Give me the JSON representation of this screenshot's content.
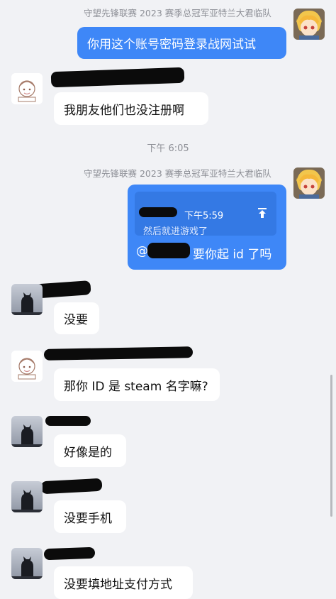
{
  "messages": {
    "m1": {
      "sender": "守望先锋联赛 2023 赛季总冠军亚特兰大君临队",
      "text": "你用这个账号密码登录战网试试"
    },
    "m2": {
      "text": "我朋友他们也没注册啊"
    },
    "time1": "下午 6:05",
    "m3": {
      "sender": "守望先锋联赛 2023 赛季总冠军亚特兰大君临队",
      "quote_time": "下午5:59",
      "quote_text": "然后就进游戏了",
      "at_prefix": "@",
      "text": "要你起 id 了吗"
    },
    "m4": {
      "text": "没要"
    },
    "m5": {
      "text": "那你 ID 是 steam 名字嘛?"
    },
    "m6": {
      "text": "好像是的"
    },
    "m7": {
      "text": "没要手机"
    },
    "m8": {
      "text": "没要填地址支付方式"
    }
  },
  "colors": {
    "background": "#f1f2f5",
    "self_bubble": "#3e87f7",
    "other_bubble": "#ffffff"
  },
  "icons": [
    "anime-avatar-icon",
    "sketch-avatar-icon",
    "cat-avatar-icon",
    "jump-to-message-icon"
  ]
}
